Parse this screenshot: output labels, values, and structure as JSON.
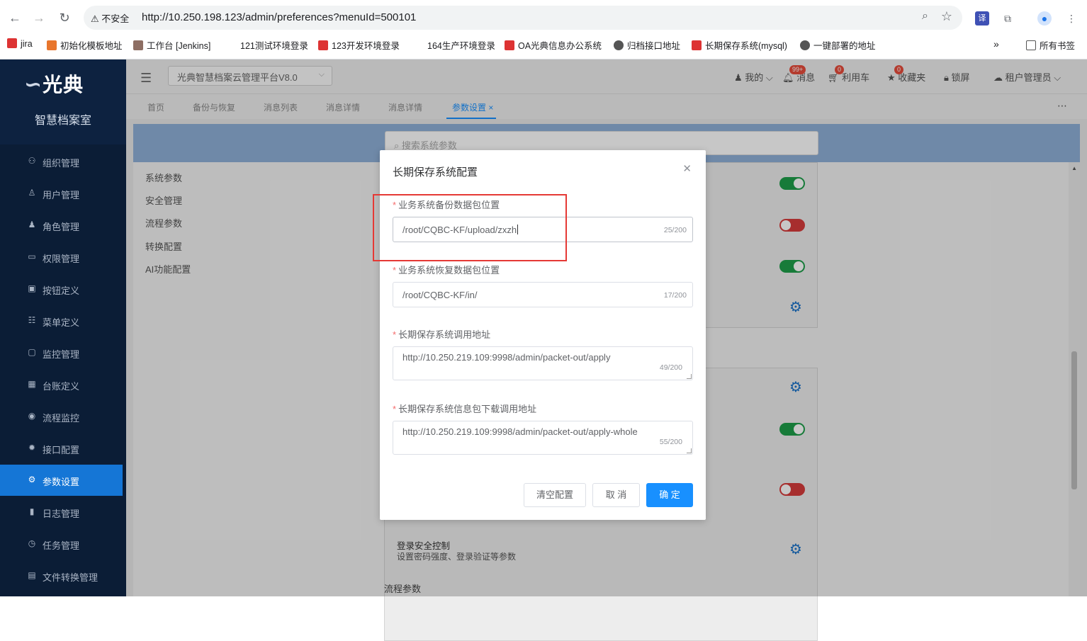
{
  "browser": {
    "security": "不安全",
    "url": "http://10.250.198.123/admin/preferences?menuId=500101",
    "bookmarks": [
      {
        "label": "jira",
        "color": "#d33"
      },
      {
        "label": "初始化模板地址",
        "color": "#e8762d"
      },
      {
        "label": "工作台 [Jenkins]",
        "color": "#8d6e63"
      },
      {
        "label": "121测试环境登录",
        "color": "#ffffff"
      },
      {
        "label": "123开发环境登录",
        "color": "#d33"
      },
      {
        "label": "164生产环境登录",
        "color": "#ffffff"
      },
      {
        "label": "OA光典信息办公系统",
        "color": "#d33"
      },
      {
        "label": "归档接口地址",
        "color": "#555"
      },
      {
        "label": "长期保存系统(mysql)",
        "color": "#d33"
      },
      {
        "label": "一键部署的地址",
        "color": "#555"
      }
    ],
    "all_bookmarks": "所有书签"
  },
  "sidebar": {
    "logo": "光典",
    "subtitle": "智慧档案室",
    "items": [
      {
        "label": "组织管理",
        "icon": "⚇"
      },
      {
        "label": "用户管理",
        "icon": "♙"
      },
      {
        "label": "角色管理",
        "icon": "♟"
      },
      {
        "label": "权限管理",
        "icon": "▭"
      },
      {
        "label": "按钮定义",
        "icon": "▣"
      },
      {
        "label": "菜单定义",
        "icon": "☷"
      },
      {
        "label": "监控管理",
        "icon": "▢"
      },
      {
        "label": "台账定义",
        "icon": "▦"
      },
      {
        "label": "流程监控",
        "icon": "◉"
      },
      {
        "label": "接口配置",
        "icon": "✹"
      },
      {
        "label": "参数设置",
        "icon": "⚙"
      },
      {
        "label": "日志管理",
        "icon": "▮"
      },
      {
        "label": "任务管理",
        "icon": "◷"
      },
      {
        "label": "文件转换管理",
        "icon": "▤"
      }
    ]
  },
  "topbar": {
    "platform": "光典智慧档案云管理平台V8.0",
    "mine": "我的",
    "message": "消息",
    "message_badge": "99+",
    "cart": "利用车",
    "cart_badge": "0",
    "favorites": "收藏夹",
    "favorites_badge": "0",
    "lock": "锁屏",
    "tenant": "租户管理员"
  },
  "tabs": [
    "首页",
    "备份与恢复",
    "消息列表",
    "消息详情",
    "消息详情",
    "参数设置"
  ],
  "content": {
    "search_placeholder": "搜索系统参数",
    "left_nav": [
      "系统参数",
      "安全管理",
      "流程参数",
      "转换配置",
      "AI功能配置"
    ],
    "login_title": "登录安全控制",
    "login_desc": "设置密码强度、登录验证等参数",
    "flow_section": "流程参数"
  },
  "dialog": {
    "title": "长期保存系统配置",
    "fields": [
      {
        "label": "业务系统备份数据包位置",
        "value": "/root/CQBC-KF/upload/zxzh",
        "count": "25/200"
      },
      {
        "label": "业务系统恢复数据包位置",
        "value": "/root/CQBC-KF/in/",
        "count": "17/200"
      },
      {
        "label": "长期保存系统调用地址",
        "value": "http://10.250.219.109:9998/admin/packet-out/apply",
        "count": "49/200"
      },
      {
        "label": "长期保存系统信息包下载调用地址",
        "value": "http://10.250.219.109:9998/admin/packet-out/apply-whole",
        "count": "55/200"
      }
    ],
    "clear_button": "清空配置",
    "cancel_button": "取 消",
    "confirm_button": "确 定"
  },
  "colors": {
    "accent": "#1890ff",
    "sidebar_bg": "#0b1d36",
    "active_menu": "#1576d6",
    "toggle_on": "#1e9e4a",
    "toggle_off": "#d63b3b",
    "highlight": "#e53935"
  }
}
